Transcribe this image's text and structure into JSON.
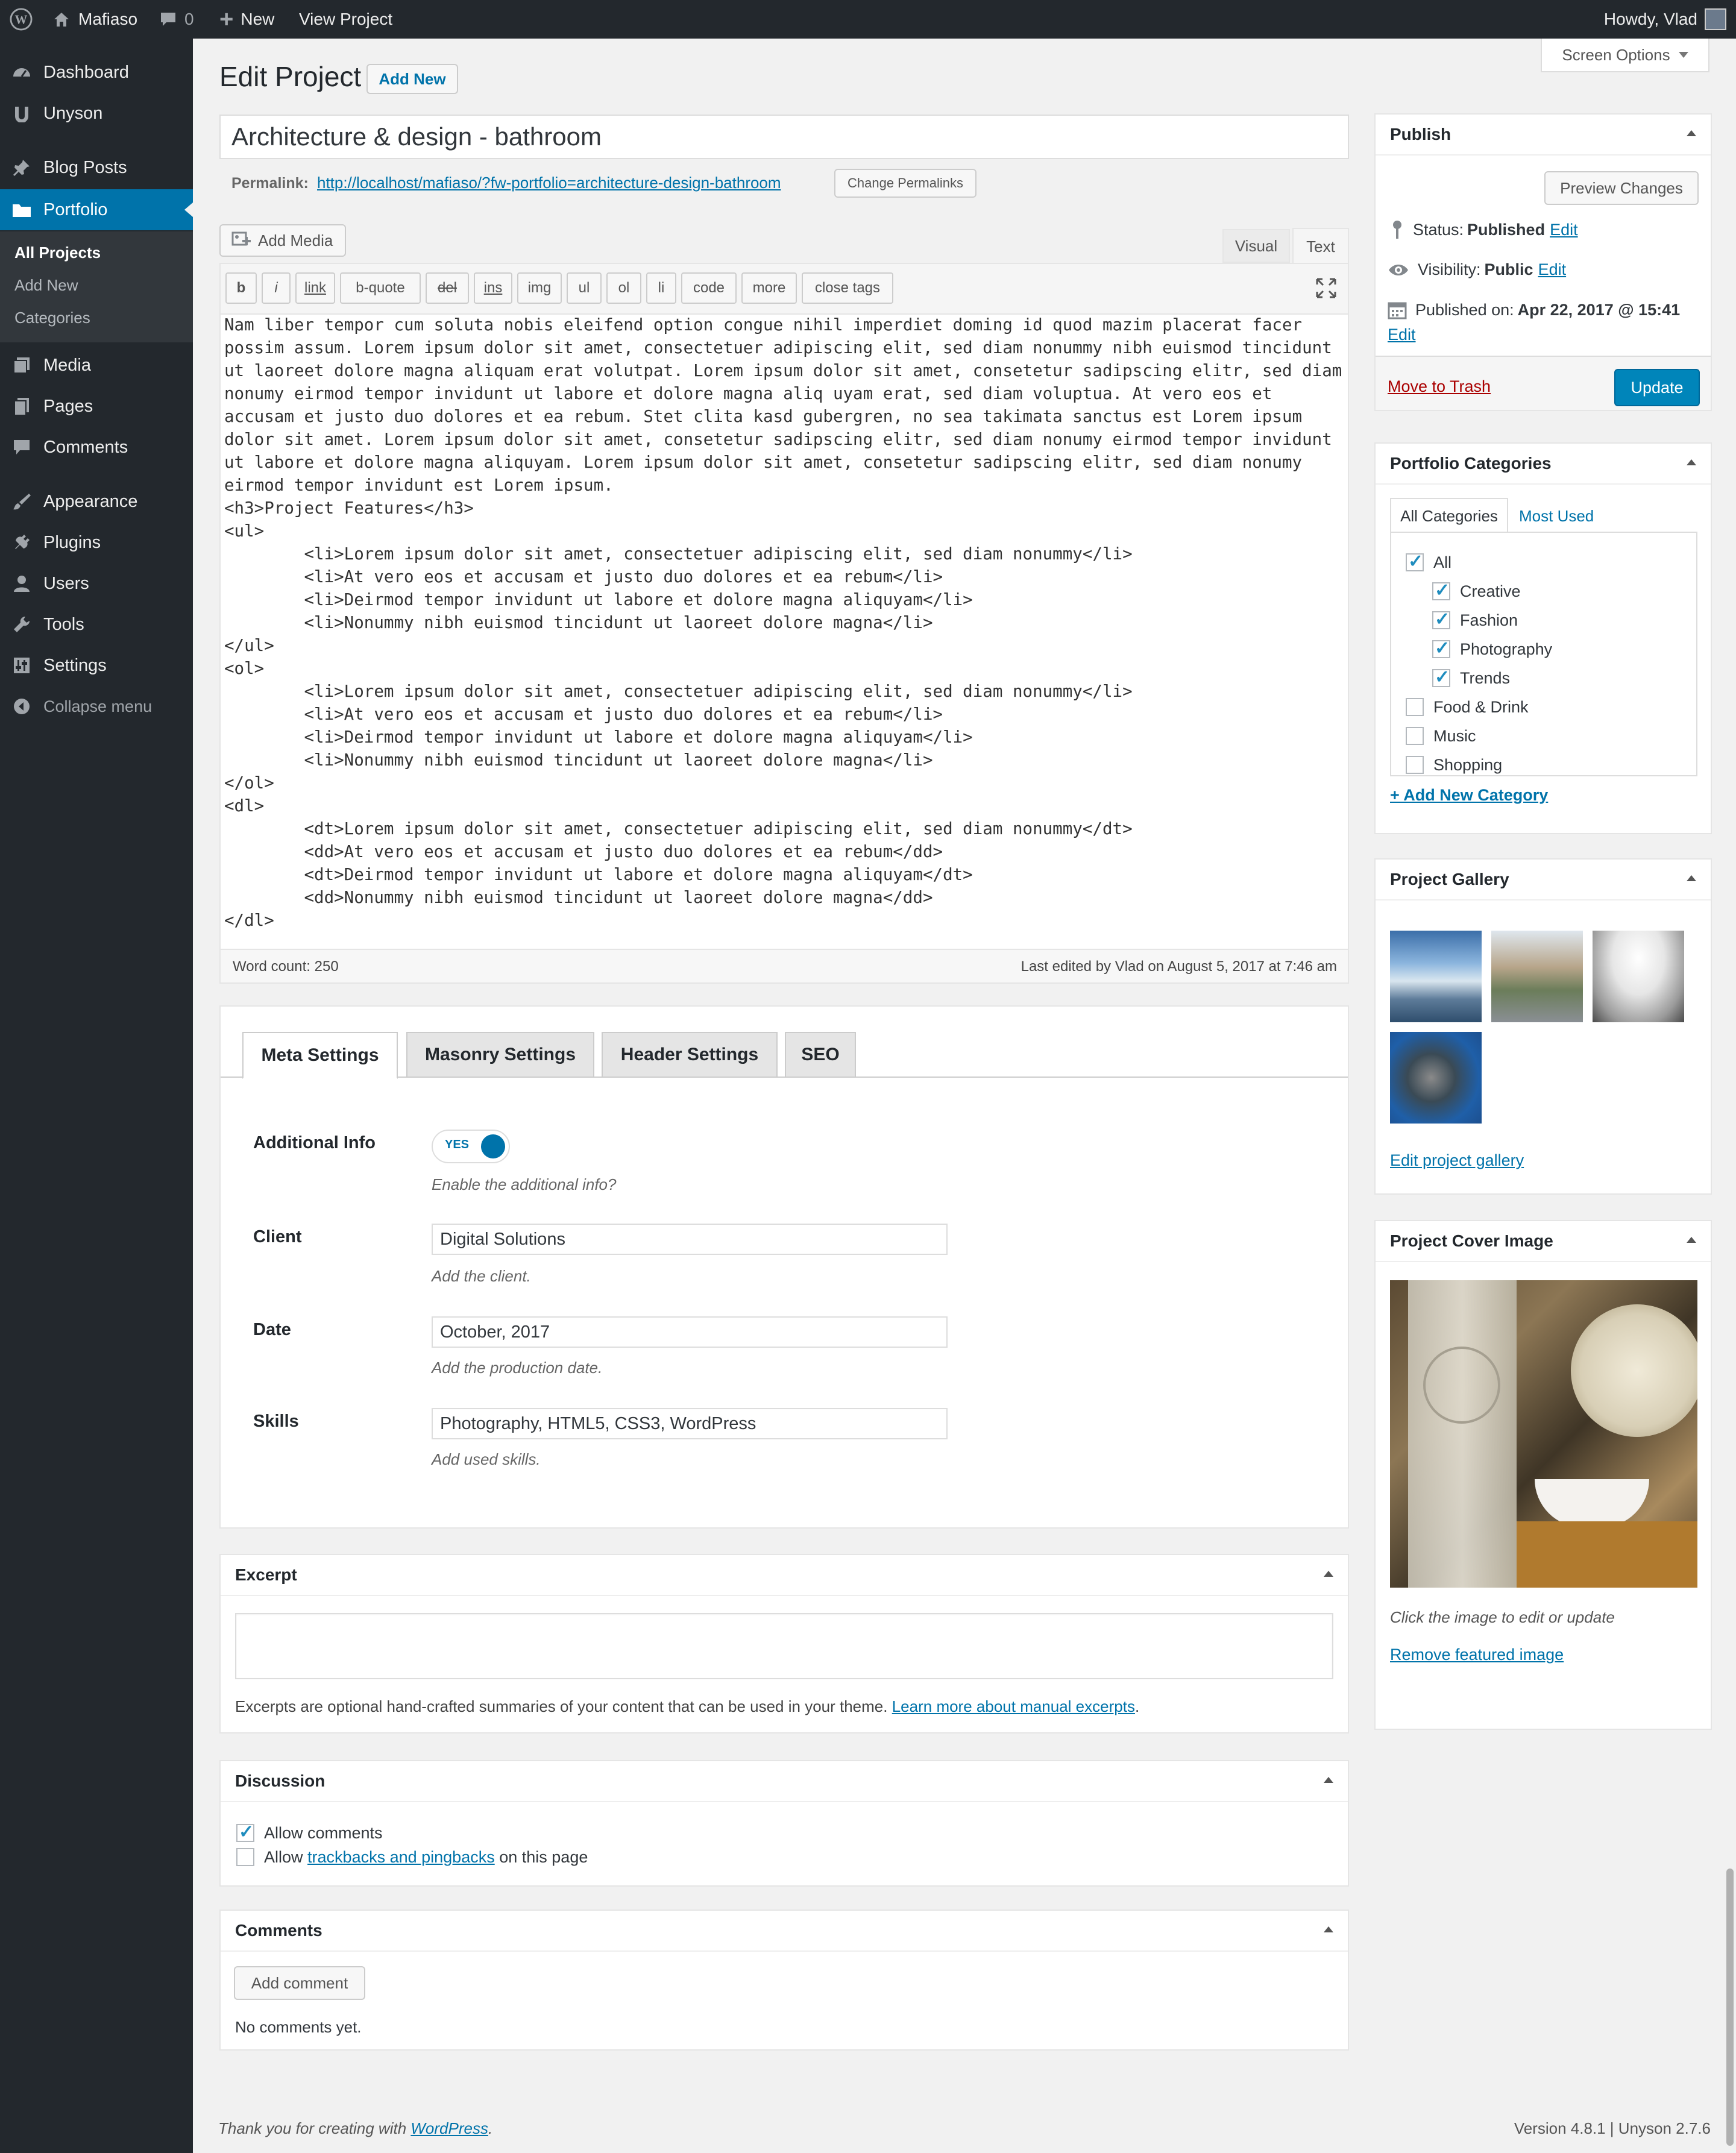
{
  "adminbar": {
    "site_name": "Mafiaso",
    "comments_count": "0",
    "new_label": "New",
    "view_label": "View Project",
    "howdy": "Howdy, Vlad"
  },
  "sidebar": {
    "items": [
      {
        "label": "Dashboard",
        "icon": "dashboard-icon"
      },
      {
        "label": "Unyson",
        "icon": "unyson-icon"
      },
      {
        "label": "Blog Posts",
        "icon": "pin-icon"
      },
      {
        "label": "Portfolio",
        "icon": "folder-icon"
      },
      {
        "label": "Media",
        "icon": "media-icon"
      },
      {
        "label": "Pages",
        "icon": "pages-icon"
      },
      {
        "label": "Comments",
        "icon": "comment-icon"
      },
      {
        "label": "Appearance",
        "icon": "brush-icon"
      },
      {
        "label": "Plugins",
        "icon": "plugin-icon"
      },
      {
        "label": "Users",
        "icon": "user-icon"
      },
      {
        "label": "Tools",
        "icon": "wrench-icon"
      },
      {
        "label": "Settings",
        "icon": "settings-icon"
      },
      {
        "label": "Collapse menu",
        "icon": "collapse-icon"
      }
    ],
    "submenu": [
      "All Projects",
      "Add New",
      "Categories"
    ]
  },
  "header": {
    "title": "Edit Project",
    "add_new": "Add New",
    "screen_options": "Screen Options"
  },
  "post": {
    "title": "Architecture & design - bathroom",
    "permalink_label": "Permalink:",
    "permalink_url": "http://localhost/mafiaso/?fw-portfolio=architecture-design-bathroom",
    "change_permalinks": "Change Permalinks",
    "add_media": "Add Media",
    "tab_visual": "Visual",
    "tab_text": "Text",
    "quicktags": [
      "b",
      "i",
      "link",
      "b-quote",
      "del",
      "ins",
      "img",
      "ul",
      "ol",
      "li",
      "code",
      "more",
      "close tags"
    ],
    "content": "Nam liber tempor cum soluta nobis eleifend option congue nihil imperdiet doming id quod mazim placerat facer possim assum. Lorem ipsum dolor sit amet, consectetuer adipiscing elit, sed diam nonummy nibh euismod tincidunt ut laoreet dolore magna aliquam erat volutpat. Lorem ipsum dolor sit amet, consetetur sadipscing elitr, sed diam nonumy eirmod tempor invidunt ut labore et dolore magna aliq uyam erat, sed diam voluptua. At vero eos et accusam et justo duo dolores et ea rebum. Stet clita kasd gubergren, no sea takimata sanctus est Lorem ipsum dolor sit amet. Lorem ipsum dolor sit amet, consetetur sadipscing elitr, sed diam nonumy eirmod tempor invidunt ut labore et dolore magna aliquyam. Lorem ipsum dolor sit amet, consetetur sadipscing elitr, sed diam nonumy eirmod tempor invidunt est Lorem ipsum.\n<h3>Project Features</h3>\n<ul>\n        <li>Lorem ipsum dolor sit amet, consectetuer adipiscing elit, sed diam nonummy</li>\n        <li>At vero eos et accusam et justo duo dolores et ea rebum</li>\n        <li>Deirmod tempor invidunt ut labore et dolore magna aliquyam</li>\n        <li>Nonummy nibh euismod tincidunt ut laoreet dolore magna</li>\n</ul>\n<ol>\n        <li>Lorem ipsum dolor sit amet, consectetuer adipiscing elit, sed diam nonummy</li>\n        <li>At vero eos et accusam et justo duo dolores et ea rebum</li>\n        <li>Deirmod tempor invidunt ut labore et dolore magna aliquyam</li>\n        <li>Nonummy nibh euismod tincidunt ut laoreet dolore magna</li>\n</ol>\n<dl>\n        <dt>Lorem ipsum dolor sit amet, consectetuer adipiscing elit, sed diam nonummy</dt>\n        <dd>At vero eos et accusam et justo duo dolores et ea rebum</dd>\n        <dt>Deirmod tempor invidunt ut labore et dolore magna aliquyam</dt>\n        <dd>Nonummy nibh euismod tincidunt ut laoreet dolore magna</dd>\n</dl>",
    "word_count": "Word count: 250",
    "last_edited": "Last edited by Vlad on August 5, 2017 at 7:46 am"
  },
  "meta_tabs": [
    "Meta Settings",
    "Masonry Settings",
    "Header Settings",
    "SEO"
  ],
  "meta": {
    "additional_info_label": "Additional Info",
    "toggle_value": "YES",
    "additional_info_desc": "Enable the additional info?",
    "client_label": "Client",
    "client_value": "Digital Solutions",
    "client_desc": "Add the client.",
    "date_label": "Date",
    "date_value": "October, 2017",
    "date_desc": "Add the production date.",
    "skills_label": "Skills",
    "skills_value": "Photography, HTML5, CSS3, WordPress",
    "skills_desc": "Add used skills."
  },
  "excerpt": {
    "title": "Excerpt",
    "desc": "Excerpts are optional hand-crafted summaries of your content that can be used in your theme.",
    "link": "Learn more about manual excerpts",
    "end": "."
  },
  "discussion": {
    "title": "Discussion",
    "allow_comments": "Allow comments",
    "allow_prefix": "Allow",
    "trackbacks_link": "trackbacks and pingbacks",
    "allow_suffix": "on this page"
  },
  "comments": {
    "title": "Comments",
    "add_button": "Add comment",
    "none": "No comments yet."
  },
  "publish": {
    "title": "Publish",
    "preview": "Preview Changes",
    "status_label": "Status:",
    "status_value": "Published",
    "visibility_label": "Visibility:",
    "visibility_value": "Public",
    "published_label": "Published on:",
    "published_value": "Apr 22, 2017 @ 15:41",
    "edit": "Edit",
    "trash": "Move to Trash",
    "update": "Update"
  },
  "categories": {
    "title": "Portfolio Categories",
    "tab_all": "All Categories",
    "tab_used": "Most Used",
    "items": [
      "All",
      "Creative",
      "Fashion",
      "Photography",
      "Trends",
      "Food & Drink",
      "Music",
      "Shopping"
    ],
    "add_new": "+ Add New Category"
  },
  "gallery": {
    "title": "Project Gallery",
    "edit_link": "Edit project gallery"
  },
  "cover": {
    "title": "Project Cover Image",
    "hint": "Click the image to edit or update",
    "remove": "Remove featured image"
  },
  "footer": {
    "thanks": "Thank you for creating with",
    "wp_link": "WordPress",
    "period": ".",
    "version": "Version 4.8.1 | Unyson 2.7.6"
  },
  "colors": {
    "primary": "#0073aa",
    "adminbar": "#23282d",
    "update_button": "#0085ba",
    "trash": "#a00"
  }
}
